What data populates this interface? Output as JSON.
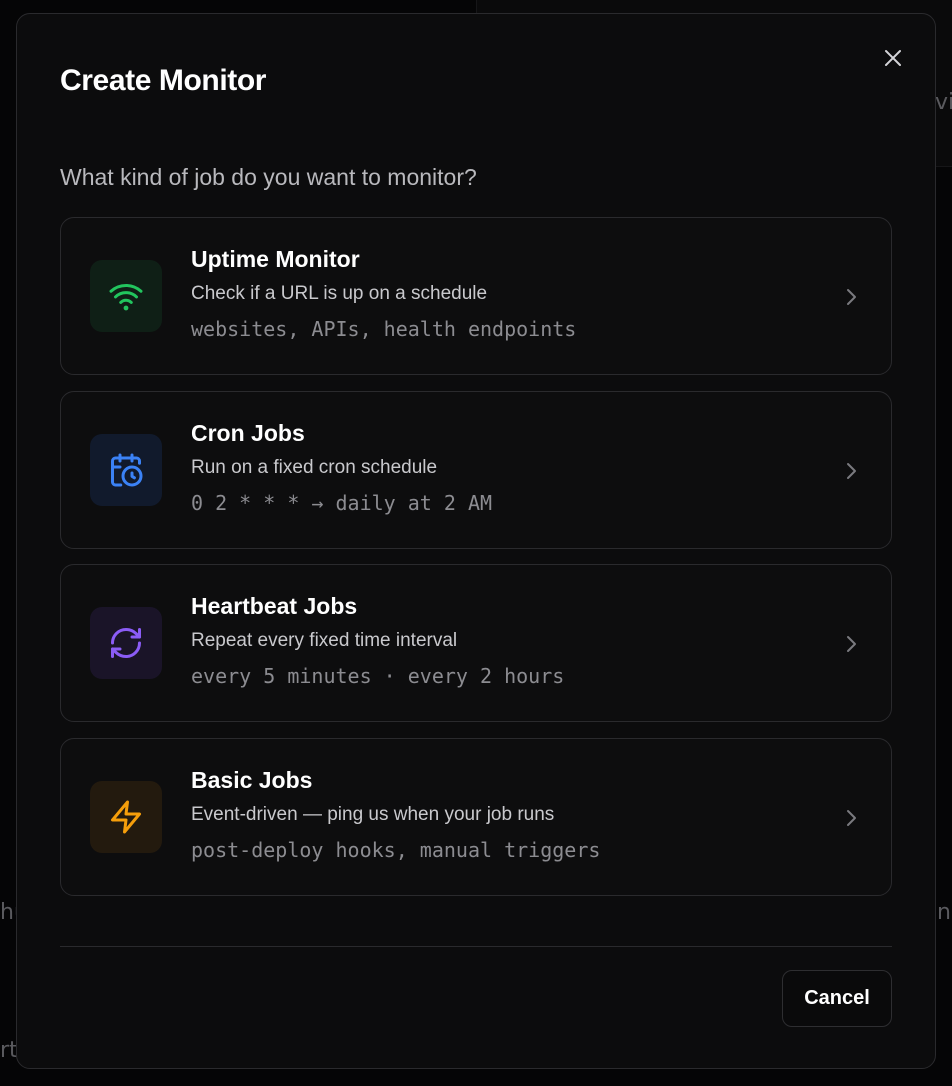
{
  "modal": {
    "title": "Create Monitor",
    "close_icon": "close-icon",
    "prompt": "What kind of job do you want to monitor?",
    "options": [
      {
        "title": "Uptime Monitor",
        "description": "Check if a URL is up on a schedule",
        "example": "websites, APIs, health endpoints",
        "icon": "wifi-icon",
        "accent": "#22c55e",
        "tile_bg": "#0f1f16"
      },
      {
        "title": "Cron Jobs",
        "description": "Run on a fixed cron schedule",
        "example": "0 2 * * * → daily at 2 AM",
        "icon": "calendar-clock-icon",
        "accent": "#3b82f6",
        "tile_bg": "#111a2c"
      },
      {
        "title": "Heartbeat Jobs",
        "description": "Repeat every fixed time interval",
        "example": "every 5 minutes · every 2 hours",
        "icon": "refresh-icon",
        "accent": "#8b5cf6",
        "tile_bg": "#1a1428"
      },
      {
        "title": "Basic Jobs",
        "description": "Event-driven — ping us when your job runs",
        "example": "post-deploy hooks, manual triggers",
        "icon": "lightning-icon",
        "accent": "#f59e0b",
        "tile_bg": "#231a0e"
      }
    ],
    "chevron_icon": "chevron-right-icon",
    "cancel_label": "Cancel"
  }
}
